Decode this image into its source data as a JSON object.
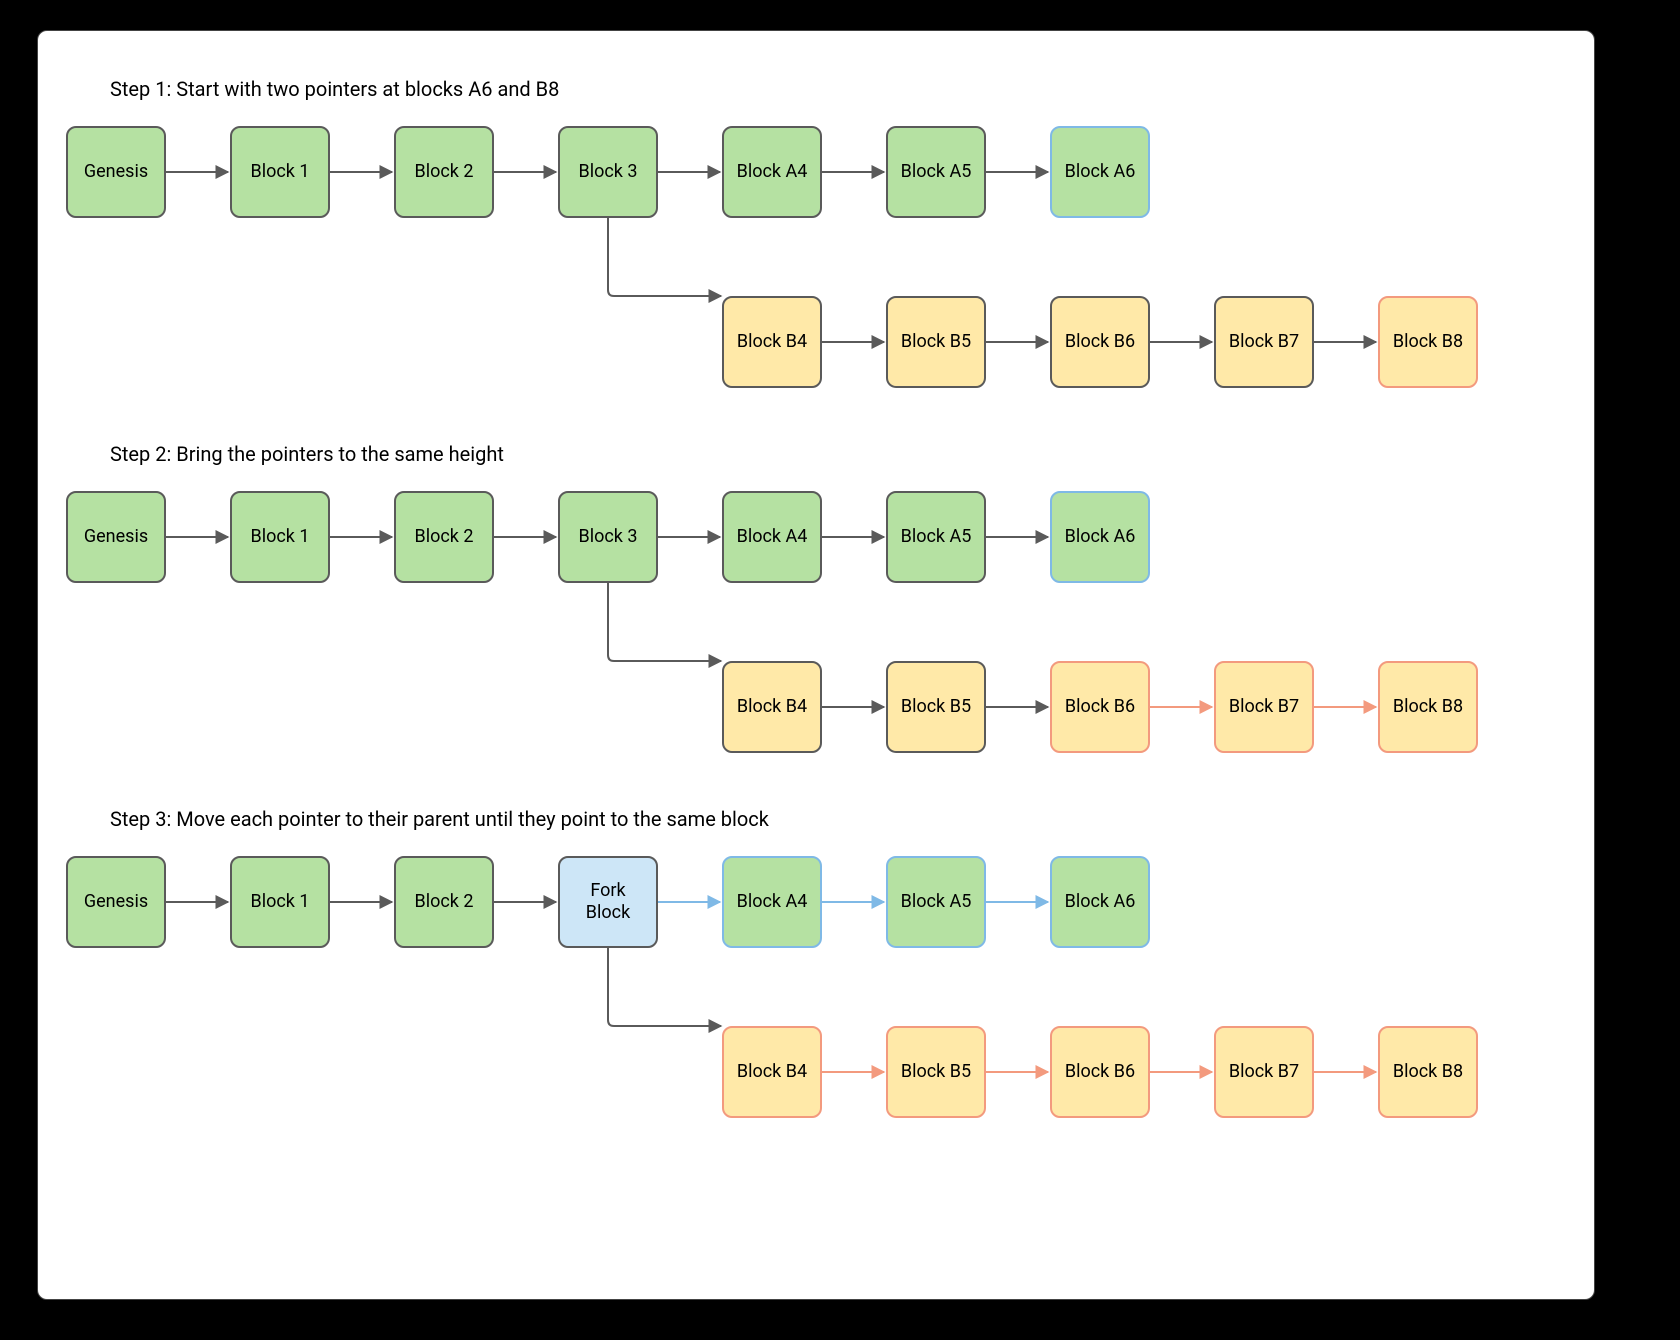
{
  "steps": {
    "1": "Step 1: Start with two pointers at blocks A6 and B8",
    "2": "Step 2: Bring the pointers to the same height",
    "3": "Step 3: Move each pointer to their parent until they point to the same block"
  },
  "labels": {
    "genesis": "Genesis",
    "block1": "Block 1",
    "block2": "Block 2",
    "block3": "Block 3",
    "blockA4": "Block A4",
    "blockA5": "Block A5",
    "blockA6": "Block A6",
    "blockB4": "Block B4",
    "blockB5": "Block B5",
    "blockB6": "Block B6",
    "blockB7": "Block B7",
    "blockB8": "Block B8",
    "forkBlock": "Fork\nBlock"
  },
  "colors": {
    "green_fill": "#b5e1a2",
    "yellow_fill": "#ffe9a8",
    "blue_fill": "#cde6f7",
    "default_border": "#5a5a5a",
    "blue_border": "#7fb9e6",
    "red_border": "#f39a7e",
    "arrow_default": "#5a5a5a",
    "arrow_blue": "#7fb9e6",
    "arrow_red": "#f39a7e"
  },
  "chart_data": {
    "type": "flowchart",
    "title": "Finding common ancestor (fork block) of two blockchain forks",
    "steps": [
      {
        "id": 1,
        "title": "Start with two pointers at blocks A6 and B8",
        "nodes": [
          {
            "id": "G",
            "label": "Genesis",
            "style": "green"
          },
          {
            "id": "1",
            "label": "Block 1",
            "style": "green"
          },
          {
            "id": "2",
            "label": "Block 2",
            "style": "green"
          },
          {
            "id": "3",
            "label": "Block 3",
            "style": "green"
          },
          {
            "id": "A4",
            "label": "Block A4",
            "style": "green"
          },
          {
            "id": "A5",
            "label": "Block A5",
            "style": "green"
          },
          {
            "id": "A6",
            "label": "Block A6",
            "style": "green-blue",
            "pointer": "A"
          },
          {
            "id": "B4",
            "label": "Block B4",
            "style": "yellow"
          },
          {
            "id": "B5",
            "label": "Block B5",
            "style": "yellow"
          },
          {
            "id": "B6",
            "label": "Block B6",
            "style": "yellow"
          },
          {
            "id": "B7",
            "label": "Block B7",
            "style": "yellow"
          },
          {
            "id": "B8",
            "label": "Block B8",
            "style": "yellow-red",
            "pointer": "B"
          }
        ],
        "edges": [
          {
            "from": "G",
            "to": "1",
            "style": "gray"
          },
          {
            "from": "1",
            "to": "2",
            "style": "gray"
          },
          {
            "from": "2",
            "to": "3",
            "style": "gray"
          },
          {
            "from": "3",
            "to": "A4",
            "style": "gray"
          },
          {
            "from": "A4",
            "to": "A5",
            "style": "gray"
          },
          {
            "from": "A5",
            "to": "A6",
            "style": "gray"
          },
          {
            "from": "3",
            "to": "B4",
            "style": "gray"
          },
          {
            "from": "B4",
            "to": "B5",
            "style": "gray"
          },
          {
            "from": "B5",
            "to": "B6",
            "style": "gray"
          },
          {
            "from": "B6",
            "to": "B7",
            "style": "gray"
          },
          {
            "from": "B7",
            "to": "B8",
            "style": "gray"
          }
        ]
      },
      {
        "id": 2,
        "title": "Bring the pointers to the same height",
        "nodes": [
          {
            "id": "G",
            "label": "Genesis",
            "style": "green"
          },
          {
            "id": "1",
            "label": "Block 1",
            "style": "green"
          },
          {
            "id": "2",
            "label": "Block 2",
            "style": "green"
          },
          {
            "id": "3",
            "label": "Block 3",
            "style": "green"
          },
          {
            "id": "A4",
            "label": "Block A4",
            "style": "green"
          },
          {
            "id": "A5",
            "label": "Block A5",
            "style": "green"
          },
          {
            "id": "A6",
            "label": "Block A6",
            "style": "green-blue",
            "pointer": "A"
          },
          {
            "id": "B4",
            "label": "Block B4",
            "style": "yellow"
          },
          {
            "id": "B5",
            "label": "Block B5",
            "style": "yellow"
          },
          {
            "id": "B6",
            "label": "Block B6",
            "style": "yellow-red",
            "pointer": "B"
          },
          {
            "id": "B7",
            "label": "Block B7",
            "style": "yellow-red"
          },
          {
            "id": "B8",
            "label": "Block B8",
            "style": "yellow-red"
          }
        ],
        "edges": [
          {
            "from": "G",
            "to": "1",
            "style": "gray"
          },
          {
            "from": "1",
            "to": "2",
            "style": "gray"
          },
          {
            "from": "2",
            "to": "3",
            "style": "gray"
          },
          {
            "from": "3",
            "to": "A4",
            "style": "gray"
          },
          {
            "from": "A4",
            "to": "A5",
            "style": "gray"
          },
          {
            "from": "A5",
            "to": "A6",
            "style": "gray"
          },
          {
            "from": "3",
            "to": "B4",
            "style": "gray"
          },
          {
            "from": "B4",
            "to": "B5",
            "style": "gray"
          },
          {
            "from": "B5",
            "to": "B6",
            "style": "gray"
          },
          {
            "from": "B6",
            "to": "B7",
            "style": "red"
          },
          {
            "from": "B7",
            "to": "B8",
            "style": "red"
          }
        ]
      },
      {
        "id": 3,
        "title": "Move each pointer to their parent until they point to the same block",
        "nodes": [
          {
            "id": "G",
            "label": "Genesis",
            "style": "green"
          },
          {
            "id": "1",
            "label": "Block 1",
            "style": "green"
          },
          {
            "id": "2",
            "label": "Block 2",
            "style": "green"
          },
          {
            "id": "Fork",
            "label": "Fork Block",
            "style": "blue",
            "pointer": "both"
          },
          {
            "id": "A4",
            "label": "Block A4",
            "style": "green-blue"
          },
          {
            "id": "A5",
            "label": "Block A5",
            "style": "green-blue"
          },
          {
            "id": "A6",
            "label": "Block A6",
            "style": "green-blue"
          },
          {
            "id": "B4",
            "label": "Block B4",
            "style": "yellow-red"
          },
          {
            "id": "B5",
            "label": "Block B5",
            "style": "yellow-red"
          },
          {
            "id": "B6",
            "label": "Block B6",
            "style": "yellow-red"
          },
          {
            "id": "B7",
            "label": "Block B7",
            "style": "yellow-red"
          },
          {
            "id": "B8",
            "label": "Block B8",
            "style": "yellow-red"
          }
        ],
        "edges": [
          {
            "from": "G",
            "to": "1",
            "style": "gray"
          },
          {
            "from": "1",
            "to": "2",
            "style": "gray"
          },
          {
            "from": "2",
            "to": "Fork",
            "style": "gray"
          },
          {
            "from": "Fork",
            "to": "A4",
            "style": "blue"
          },
          {
            "from": "A4",
            "to": "A5",
            "style": "blue"
          },
          {
            "from": "A5",
            "to": "A6",
            "style": "blue"
          },
          {
            "from": "Fork",
            "to": "B4",
            "style": "gray"
          },
          {
            "from": "B4",
            "to": "B5",
            "style": "red"
          },
          {
            "from": "B5",
            "to": "B6",
            "style": "red"
          },
          {
            "from": "B6",
            "to": "B7",
            "style": "red"
          },
          {
            "from": "B7",
            "to": "B8",
            "style": "red"
          }
        ]
      }
    ]
  }
}
